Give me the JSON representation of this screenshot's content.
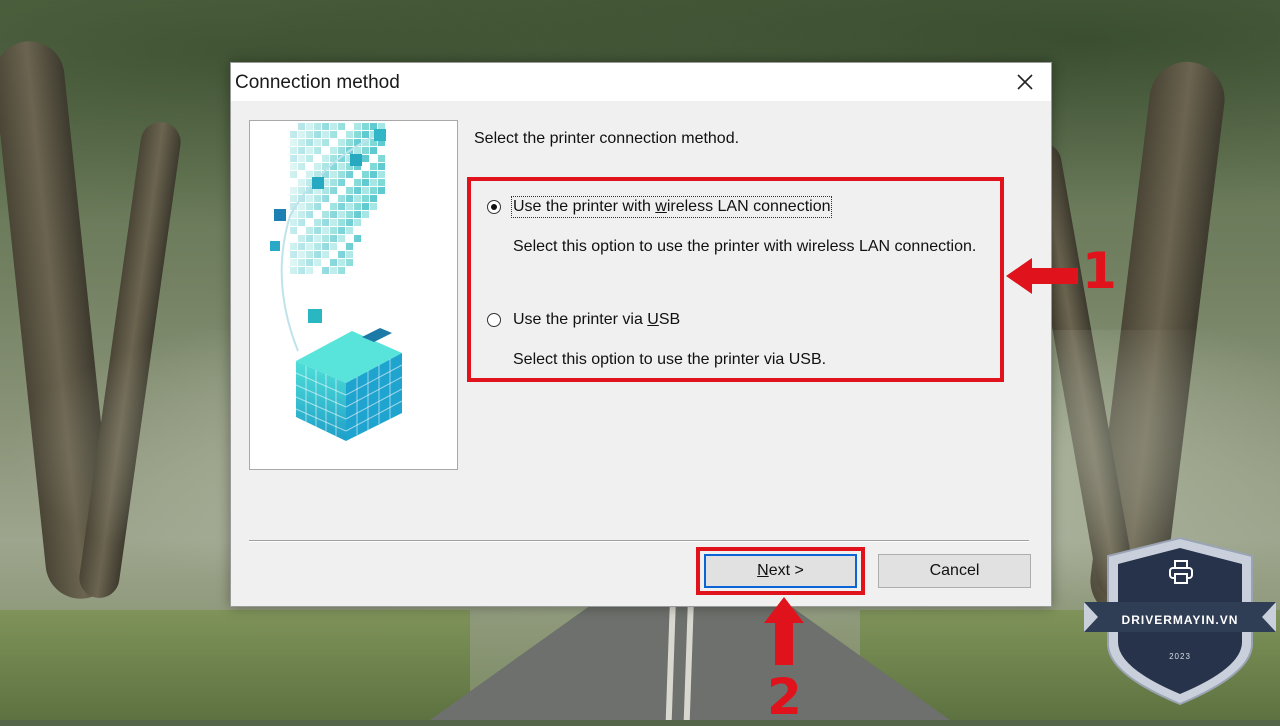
{
  "dialog": {
    "title": "Connection method",
    "prompt": "Select the printer connection method.",
    "options": [
      {
        "label_pre": "Use the printer with ",
        "label_accel": "w",
        "label_post": "ireless LAN connection",
        "description": "Select this option to use the printer with wireless LAN connection.",
        "selected": true
      },
      {
        "label_pre": "Use the printer via ",
        "label_accel": "U",
        "label_post": "SB",
        "description": "Select this option to use the printer via USB.",
        "selected": false
      }
    ],
    "buttons": {
      "next_accel": "N",
      "next_post": "ext >",
      "cancel": "Cancel"
    }
  },
  "annotations": {
    "step1": "1",
    "step2": "2",
    "highlight_color": "#e0121b"
  },
  "badge": {
    "site": "DRIVERMAYIN.VN",
    "year": "2023",
    "icon": "printer-icon"
  }
}
